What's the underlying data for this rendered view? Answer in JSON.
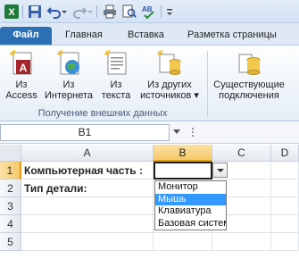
{
  "toolbar": {
    "icons": [
      "excel-icon",
      "save-icon",
      "undo-icon",
      "redo-icon",
      "print-icon",
      "print-preview-icon",
      "spellcheck-icon",
      "customize-icon"
    ]
  },
  "ribbon_tabs": [
    {
      "label": "Файл"
    },
    {
      "label": "Главная"
    },
    {
      "label": "Вставка"
    },
    {
      "label": "Разметка страницы"
    }
  ],
  "ribbon": {
    "buttons": [
      {
        "line1": "Из",
        "line2": "Access",
        "icon": "access-icon"
      },
      {
        "line1": "Из",
        "line2": "Интернета",
        "icon": "web-icon"
      },
      {
        "line1": "Из",
        "line2": "текста",
        "icon": "text-file-icon"
      },
      {
        "line1": "Из других",
        "line2": "источников ▾",
        "icon": "other-sources-icon"
      },
      {
        "line1": "Существующие",
        "line2": "подключения",
        "icon": "connections-icon"
      }
    ],
    "group_label": "Получение внешних данных"
  },
  "formula_bar": {
    "name_box": "B1"
  },
  "grid": {
    "columns": [
      "A",
      "B",
      "C",
      "D"
    ],
    "selected_column": "B",
    "rows": [
      "1",
      "2",
      "3",
      "4",
      "5"
    ],
    "selected_row": "1",
    "cells": {
      "A1": "Компьютерная часть :",
      "A2": "Тип детали:"
    }
  },
  "dropdown": {
    "options": [
      "Монитор",
      "Мышь",
      "Клавиатура",
      "Базовая систем"
    ],
    "selected_index": 1
  },
  "colors": {
    "file_tab": "#2d6fb4",
    "selection_highlight": "#f5c86a",
    "list_selected": "#3399ff"
  }
}
